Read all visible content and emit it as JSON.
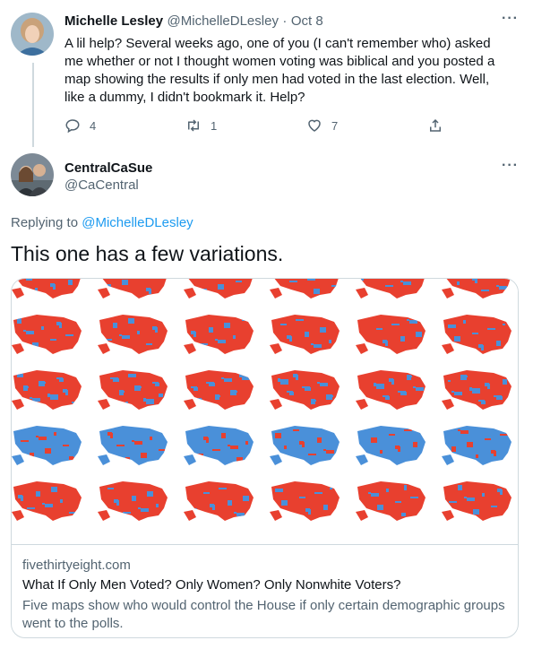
{
  "tweet1": {
    "name": "Michelle Lesley",
    "handle": "@MichelleDLesley",
    "separator": "·",
    "date": "Oct 8",
    "text": "A lil help? Several weeks ago, one of you (I can't remember who) asked me whether or not I thought women voting was biblical and you posted a map showing the results if only men had voted in the last election. Well, like a dummy, I didn't bookmark it. Help?",
    "reply_count": "4",
    "retweet_count": "1",
    "like_count": "7"
  },
  "tweet2": {
    "name": "CentralCaSue",
    "handle": "@CaCentral",
    "replying_to_label": "Replying to",
    "replying_to_handle": "@MichelleDLesley",
    "text": "This one has a few variations."
  },
  "card": {
    "domain": "fivethirtyeight.com",
    "title": "What If Only Men Voted? Only Women? Only Nonwhite Voters?",
    "description": "Five maps show who would control the House if only certain demographic groups went to the polls."
  },
  "map_grid": {
    "columns": 6,
    "rows": 5,
    "row_styles": [
      "red",
      "red",
      "red-light",
      "blue",
      "red-cut"
    ],
    "colors": {
      "red": "#e8402f",
      "blue": "#4a90d9"
    }
  },
  "icons": {
    "more": "more-icon",
    "reply": "reply-icon",
    "retweet": "retweet-icon",
    "like": "like-icon",
    "share": "share-icon"
  },
  "colors": {
    "text": "#0f1419",
    "muted": "#536471",
    "link": "#1d9bf0",
    "border": "#cfd9de"
  }
}
